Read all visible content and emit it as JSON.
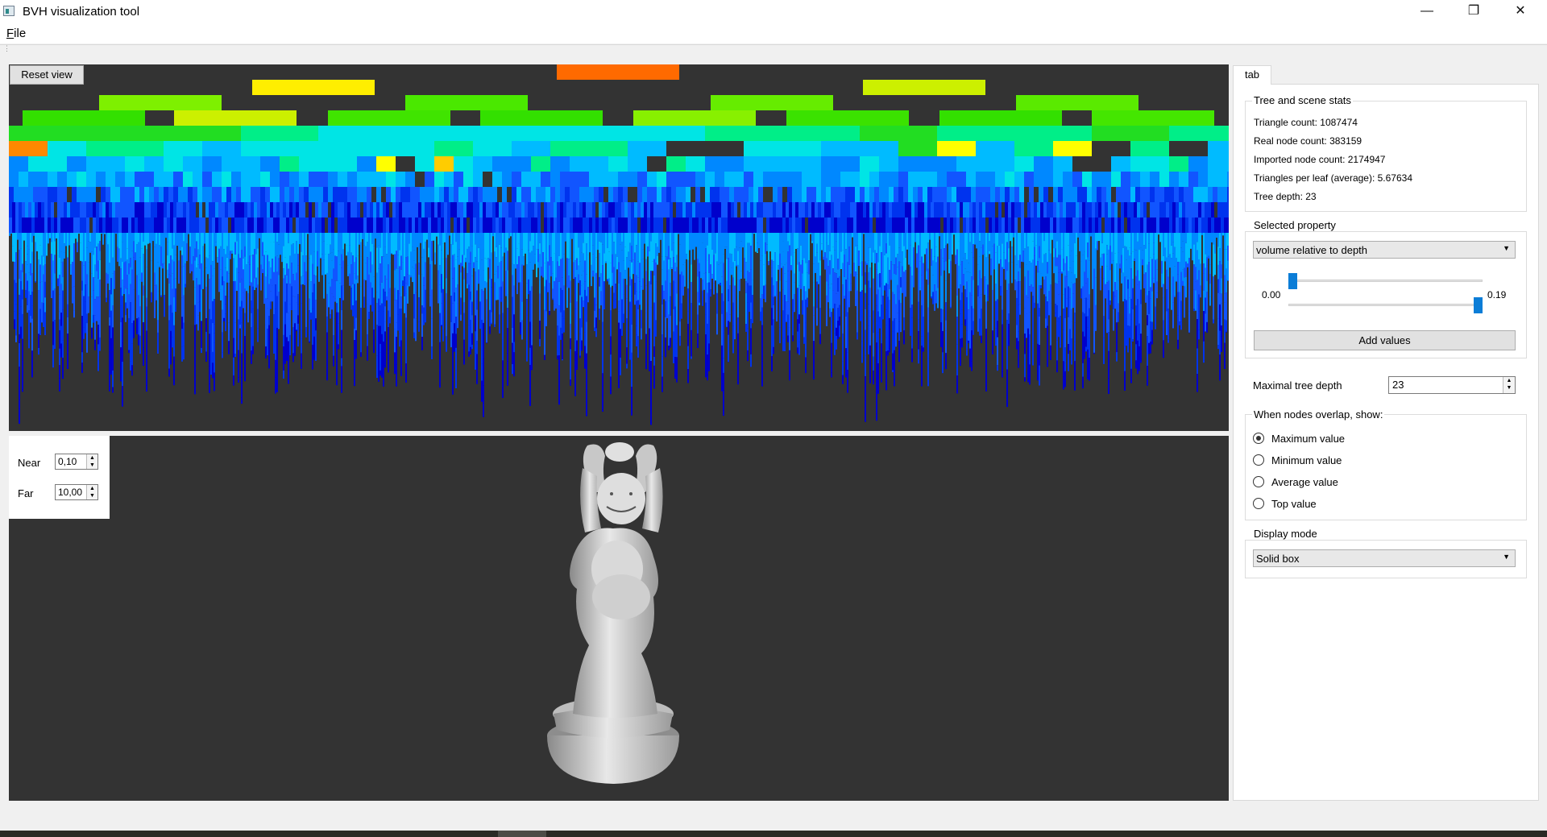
{
  "window": {
    "title": "BVH visualization tool",
    "controls": {
      "minimize": "—",
      "maximize": "❐",
      "close": "✕"
    }
  },
  "menu": {
    "file_first": "F",
    "file_rest": "ile"
  },
  "toolbar": {
    "reset_view": "Reset view"
  },
  "heatmap": {
    "top_rows": [
      [
        {
          "color": "#ff6a00"
        }
      ],
      [
        {
          "color": "#ffee00"
        },
        {
          "color": "#ccf000"
        }
      ],
      [
        {
          "color": "#7ef000"
        },
        {
          "color": "#4ae800"
        },
        {
          "color": "#66ec00"
        },
        {
          "color": "#5aea00"
        }
      ],
      [
        {
          "color": "#33e000"
        },
        {
          "color": "#ccf000"
        },
        {
          "color": "#40e400"
        },
        {
          "color": "#33e000"
        },
        {
          "color": "#88f000"
        },
        {
          "color": "#3be200"
        },
        {
          "color": "#33e000"
        },
        {
          "color": "#44e600"
        }
      ]
    ],
    "highlight_colors": [
      "#ff2200",
      "#ff8800",
      "#ffcc00",
      "#ffff00"
    ],
    "gradient_colors": [
      "#22dd22",
      "#00ee88",
      "#00e5e5",
      "#00bbff",
      "#0088ff",
      "#1155ff",
      "#0033ee",
      "#0000cc"
    ]
  },
  "camera": {
    "near_label": "Near",
    "near_value": "0,10",
    "far_label": "Far",
    "far_value": "10,00"
  },
  "side_panel": {
    "tab_label": "tab",
    "stats_title": "Tree and scene stats",
    "stats": [
      "Triangle count: 1087474",
      "Real node count: 383159",
      "Imported node count: 2174947",
      "Triangles per leaf (average): 5.67634",
      "Tree depth: 23"
    ],
    "property_title": "Selected property",
    "property_value": "volume relative to depth",
    "range_min": "0.00",
    "range_max": "0.19",
    "range_low_fraction": 0.0,
    "range_high_fraction": 1.0,
    "add_values": "Add values",
    "max_depth_label": "Maximal tree depth",
    "max_depth_value": "23",
    "overlap_title": "When nodes overlap, show:",
    "overlap_options": [
      "Maximum value",
      "Minimum value",
      "Average value",
      "Top value"
    ],
    "overlap_selected": 0,
    "display_mode_title": "Display mode",
    "display_mode_value": "Solid box"
  }
}
